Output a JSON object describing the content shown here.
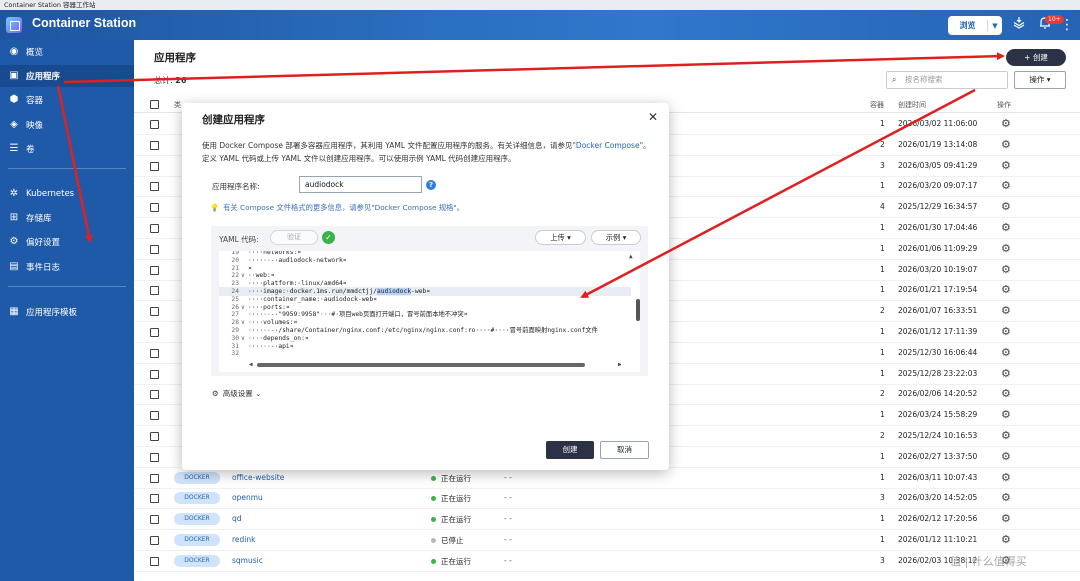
{
  "window": {
    "title": "Container Station 容器工作站"
  },
  "header": {
    "app_title": "Container Station",
    "browse_label": "浏览",
    "notification_badge": "10+"
  },
  "sidebar": {
    "items": [
      {
        "label": "概览",
        "icon": "dashboard-icon"
      },
      {
        "label": "应用程序",
        "icon": "apps-icon"
      },
      {
        "label": "容器",
        "icon": "container-icon"
      },
      {
        "label": "映像",
        "icon": "image-icon"
      },
      {
        "label": "卷",
        "icon": "volume-icon"
      },
      {
        "label": "Kubernetes",
        "icon": "kubernetes-icon"
      },
      {
        "label": "存储库",
        "icon": "repository-icon"
      },
      {
        "label": "偏好设置",
        "icon": "preferences-icon"
      },
      {
        "label": "事件日志",
        "icon": "event-log-icon"
      },
      {
        "label": "应用程序模板",
        "icon": "template-icon"
      }
    ]
  },
  "main": {
    "page_title": "应用程序",
    "total_label": "总计:",
    "total_count": "26",
    "create_label": "+ 创建",
    "search_placeholder": "按名称搜索",
    "ops_label": "操作 ▾",
    "columns": {
      "type": "类",
      "containers": "容器",
      "created": "创建时间",
      "actions": "操作"
    },
    "rows": [
      {
        "count": "1",
        "created": "2026/03/02 11:06:00"
      },
      {
        "count": "2",
        "created": "2026/01/19 13:14:08"
      },
      {
        "count": "3",
        "created": "2026/03/05 09:41:29"
      },
      {
        "count": "1",
        "created": "2026/03/20 09:07:17"
      },
      {
        "count": "4",
        "created": "2025/12/29 16:34:57"
      },
      {
        "count": "1",
        "created": "2026/01/30 17:04:46"
      },
      {
        "count": "1",
        "created": "2026/01/06 11:09:29"
      },
      {
        "count": "1",
        "created": "2026/03/20 10:19:07"
      },
      {
        "count": "1",
        "created": "2026/01/21 17:19:54"
      },
      {
        "count": "2",
        "created": "2026/01/07 16:33:51"
      },
      {
        "count": "1",
        "created": "2026/01/12 17:11:39"
      },
      {
        "count": "1",
        "created": "2025/12/30 16:06:44"
      },
      {
        "count": "1",
        "created": "2025/12/28 23:22:03"
      },
      {
        "count": "2",
        "created": "2026/02/06 14:20:52"
      },
      {
        "count": "1",
        "created": "2026/03/24 15:58:29"
      },
      {
        "count": "2",
        "created": "2025/12/24 10:16:53"
      },
      {
        "count": "1",
        "created": "2026/02/27 13:37:50"
      },
      {
        "type": "DOCKER",
        "name": "office-website",
        "status": "正在运行",
        "status_color": "#39b54a",
        "dash": "- -",
        "count": "1",
        "created": "2026/03/11 10:07:43"
      },
      {
        "type": "DOCKER",
        "name": "openmu",
        "status": "正在运行",
        "status_color": "#39b54a",
        "dash": "- -",
        "count": "3",
        "created": "2026/03/20 14:52:05"
      },
      {
        "type": "DOCKER",
        "name": "qd",
        "status": "正在运行",
        "status_color": "#39b54a",
        "dash": "- -",
        "count": "1",
        "created": "2026/02/12 17:20:56"
      },
      {
        "type": "DOCKER",
        "name": "redink",
        "status": "已停止",
        "status_color": "#b5b9bf",
        "dash": "- -",
        "count": "1",
        "created": "2026/01/12 11:10:21"
      },
      {
        "type": "DOCKER",
        "name": "sqmusic",
        "status": "正在运行",
        "status_color": "#39b54a",
        "dash": "- -",
        "count": "3",
        "created": "2026/02/03 10:38:12"
      }
    ]
  },
  "dialog": {
    "title": "创建应用程序",
    "desc_1": "使用 Docker Compose 部署多容器应用程序，其利用 YAML 文件配置应用程序的服务。有关详细信息，请参见",
    "desc_link": "\"Docker Compose\"",
    "desc_2": "。定义 YAML 代码或上传 YAML 文件以创建应用程序。可以使用示例 YAML 代码创建应用程序。",
    "name_label": "应用程序名称:",
    "name_value": "audiodock",
    "hint": "有关 Compose 文件格式的更多信息，请参见\"Docker Compose 规格\"。",
    "yaml_label": "YAML 代码:",
    "verify_label": "验证",
    "upload_label": "上传 ▾",
    "sample_label": "示例 ▾",
    "code_lines": [
      {
        "ln": "19",
        "fold": "",
        "pre": "····networks:¤",
        "sel": "",
        "post": ""
      },
      {
        "ln": "20",
        "fold": "",
        "pre": "······-·audiodock-network¤",
        "sel": "",
        "post": ""
      },
      {
        "ln": "21",
        "fold": "",
        "pre": "¤",
        "sel": "",
        "post": ""
      },
      {
        "ln": "22",
        "fold": "∨",
        "pre": "··web:¤",
        "sel": "",
        "post": ""
      },
      {
        "ln": "23",
        "fold": "",
        "pre": "····platform:·linux/amd64¤",
        "sel": "",
        "post": ""
      },
      {
        "ln": "24",
        "fold": "",
        "pre": "····image:·docker.1ms.run/mmdctjj/",
        "sel": "audiodock",
        "post": "-web¤"
      },
      {
        "ln": "25",
        "fold": "",
        "pre": "····container_name:·audiodock-web¤",
        "sel": "",
        "post": ""
      },
      {
        "ln": "26",
        "fold": "∨",
        "pre": "····ports:¤",
        "sel": "",
        "post": ""
      },
      {
        "ln": "27",
        "fold": "",
        "pre": "······-·\"9959:9958\"···#·项目web页面打开端口，冒号前面本地不冲突¤",
        "sel": "",
        "post": ""
      },
      {
        "ln": "28",
        "fold": "∨",
        "pre": "····volumes:¤",
        "sel": "",
        "post": ""
      },
      {
        "ln": "29",
        "fold": "",
        "pre": "······-·/share/Container/nginx.conf:/etc/nginx/nginx.conf:ro····#····冒号前面映射nginx.conf文件",
        "sel": "",
        "post": ""
      },
      {
        "ln": "30",
        "fold": "∨",
        "pre": "····depends_on:¤",
        "sel": "",
        "post": ""
      },
      {
        "ln": "31",
        "fold": "",
        "pre": "······-·api¤",
        "sel": "",
        "post": ""
      },
      {
        "ln": "32",
        "fold": "",
        "pre": "",
        "sel": "",
        "post": ""
      }
    ],
    "advanced_label": "高级设置",
    "create_label": "创建",
    "cancel_label": "取消"
  },
  "watermark": "值 | 什么值得买",
  "colors": {
    "accent": "#1f5aa8",
    "header": "#2a6fc0",
    "dark_button": "#2c3245",
    "annotation": "#e02020"
  }
}
